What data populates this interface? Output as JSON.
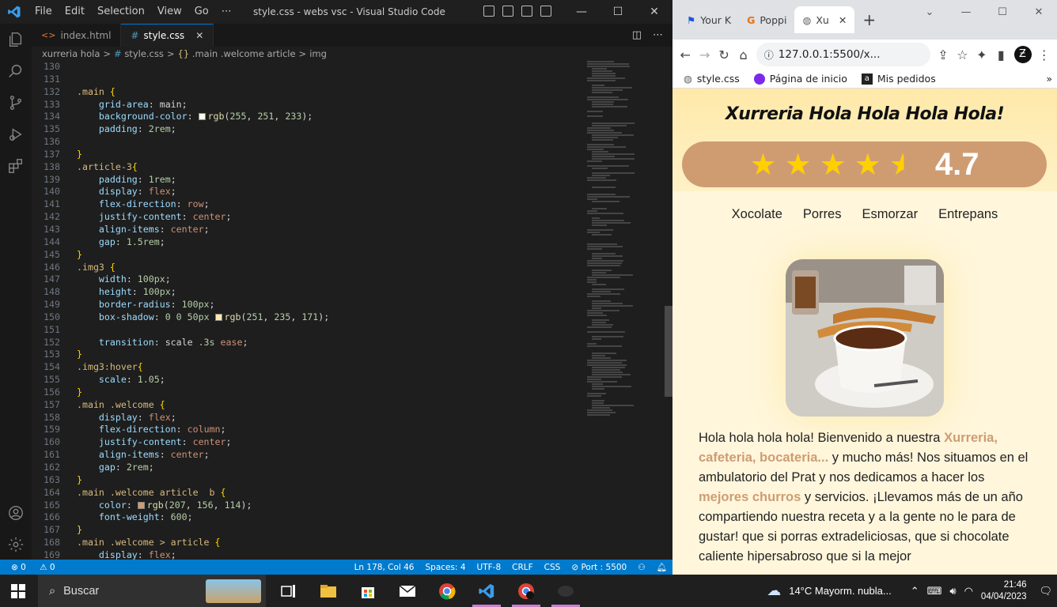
{
  "vscode": {
    "menu": [
      "File",
      "Edit",
      "Selection",
      "View",
      "Go",
      "⋯"
    ],
    "window_title": "style.css - webs vsc - Visual Studio Code",
    "tabs": [
      {
        "label": "index.html",
        "icon": "html-icon"
      },
      {
        "label": "style.css",
        "icon": "css-icon",
        "active": true
      }
    ],
    "breadcrumb": [
      "xurreria hola",
      ">",
      "style.css",
      ">",
      ".main .welcome article",
      ">",
      "img"
    ],
    "code_lines": [
      {
        "n": "130",
        "html": ""
      },
      {
        "n": "131",
        "html": ""
      },
      {
        "n": "132",
        "html": "<span class='sel'>.main</span> <span class='br'>{</span>"
      },
      {
        "n": "133",
        "html": "    <span class='prop'>grid-area</span>: main;"
      },
      {
        "n": "134",
        "html": "    <span class='prop'>background-color</span>: <span class='sw' style='background:rgb(255,251,233)'></span><span class='fn'>rgb</span>(<span class='num'>255</span>, <span class='num'>251</span>, <span class='num'>233</span>);"
      },
      {
        "n": "135",
        "html": "    <span class='prop'>padding</span>: <span class='num'>2rem</span>;"
      },
      {
        "n": "136",
        "html": ""
      },
      {
        "n": "137",
        "html": "<span class='br'>}</span>"
      },
      {
        "n": "138",
        "html": "<span class='sel'>.article-3</span><span class='br'>{</span>"
      },
      {
        "n": "139",
        "html": "    <span class='prop'>padding</span>: <span class='num'>1rem</span>;"
      },
      {
        "n": "140",
        "html": "    <span class='prop'>display</span>: <span class='str'>flex</span>;"
      },
      {
        "n": "141",
        "html": "    <span class='prop'>flex-direction</span>: <span class='str'>row</span>;"
      },
      {
        "n": "142",
        "html": "    <span class='prop'>justify-content</span>: <span class='str'>center</span>;"
      },
      {
        "n": "143",
        "html": "    <span class='prop'>align-items</span>: <span class='str'>center</span>;"
      },
      {
        "n": "144",
        "html": "    <span class='prop'>gap</span>: <span class='num'>1.5rem</span>;"
      },
      {
        "n": "145",
        "html": "<span class='br'>}</span>"
      },
      {
        "n": "146",
        "html": "<span class='sel'>.img3</span> <span class='br'>{</span>"
      },
      {
        "n": "147",
        "html": "    <span class='prop'>width</span>: <span class='num'>100px</span>;"
      },
      {
        "n": "148",
        "html": "    <span class='prop'>height</span>: <span class='num'>100px</span>;"
      },
      {
        "n": "149",
        "html": "    <span class='prop'>border-radius</span>: <span class='num'>100px</span>;"
      },
      {
        "n": "150",
        "html": "    <span class='prop'>box-shadow</span>: <span class='num'>0</span> <span class='num'>0</span> <span class='num'>50px</span> <span class='sw' style='background:rgb(251,235,171)'></span><span class='fn'>rgb</span>(<span class='num'>251</span>, <span class='num'>235</span>, <span class='num'>171</span>);"
      },
      {
        "n": "151",
        "html": ""
      },
      {
        "n": "152",
        "html": "    <span class='prop'>transition</span>: scale <span class='num'>.3s</span> <span class='str'>ease</span>;"
      },
      {
        "n": "153",
        "html": "<span class='br'>}</span>"
      },
      {
        "n": "154",
        "html": "<span class='sel'>.img3:hover</span><span class='br'>{</span>"
      },
      {
        "n": "155",
        "html": "    <span class='prop'>scale</span>: <span class='num'>1.05</span>;"
      },
      {
        "n": "156",
        "html": "<span class='br'>}</span>"
      },
      {
        "n": "157",
        "html": "<span class='sel'>.main .welcome</span> <span class='br'>{</span>"
      },
      {
        "n": "158",
        "html": "    <span class='prop'>display</span>: <span class='str'>flex</span>;"
      },
      {
        "n": "159",
        "html": "    <span class='prop'>flex-direction</span>: <span class='str'>column</span>;"
      },
      {
        "n": "160",
        "html": "    <span class='prop'>justify-content</span>: <span class='str'>center</span>;"
      },
      {
        "n": "161",
        "html": "    <span class='prop'>align-items</span>: <span class='str'>center</span>;"
      },
      {
        "n": "162",
        "html": "    <span class='prop'>gap</span>: <span class='num'>2rem</span>;"
      },
      {
        "n": "163",
        "html": "<span class='br'>}</span>"
      },
      {
        "n": "164",
        "html": "<span class='sel'>.main .welcome article  b</span> <span class='br'>{</span>"
      },
      {
        "n": "165",
        "html": "    <span class='prop'>color</span>: <span class='sw' style='background:rgb(207,156,114)'></span><span class='fn'>rgb</span>(<span class='num'>207</span>, <span class='num'>156</span>, <span class='num'>114</span>);"
      },
      {
        "n": "166",
        "html": "    <span class='prop'>font-weight</span>: <span class='num'>600</span>;"
      },
      {
        "n": "167",
        "html": "<span class='br'>}</span>"
      },
      {
        "n": "168",
        "html": "<span class='sel'>.main .welcome &gt; article</span> <span class='br'>{</span>"
      },
      {
        "n": "169",
        "html": "    <span class='prop'>display</span>: <span class='str'>flex</span>;"
      }
    ],
    "status": {
      "errors": "⊗ 0",
      "warnings": "⚠ 0",
      "position": "Ln 178, Col 46",
      "spaces": "Spaces: 4",
      "encoding": "UTF-8",
      "eol": "CRLF",
      "language": "CSS",
      "port": "⊘ Port : 5500"
    },
    "window_controls": [
      "—",
      "☐",
      "✕"
    ]
  },
  "chrome": {
    "tabs": [
      {
        "label": "Your K",
        "icon": "flag-icon"
      },
      {
        "label": "Poppi",
        "icon": "font-icon"
      },
      {
        "label": "Xu",
        "icon": "globe-icon",
        "active": true
      }
    ],
    "url": "127.0.0.1:5500/x...",
    "bookmarks": [
      {
        "label": "style.css",
        "icon": "globe-icon"
      },
      {
        "label": "Página de inicio",
        "icon": "canva-icon"
      },
      {
        "label": "Mis pedidos",
        "icon": "amazon-icon"
      }
    ],
    "window_controls": [
      "⌄",
      "—",
      "☐",
      "✕"
    ]
  },
  "page": {
    "title": "Xurreria Hola Hola Hola Hola!",
    "rating": {
      "value": 4.7,
      "label": "4.7",
      "stars": 5
    },
    "nav": [
      "Xocolate",
      "Porres",
      "Esmorzar",
      "Entrepans"
    ],
    "para": {
      "t1": "Hola hola hola hola! Bienvenido a nuestra ",
      "b1": "Xurreria, cafeteria, bocateria...",
      "t2": " y mucho más! Nos situamos en el ambulatorio del Prat y nos dedicamos a hacer los ",
      "b2": "mejores churros",
      "t3": " y servicios. ¡Llevamos más de un año compartiendo nuestra receta y a la gente no le para de gustar! que si porras extradeliciosas, que si chocolate caliente hipersabroso que si la mejor"
    }
  },
  "taskbar": {
    "search_placeholder": "Buscar",
    "weather": "14°C  Mayorm. nubla...",
    "time": "21:46",
    "date": "04/04/2023"
  },
  "colors": {
    "vscode_accent": "#007acc",
    "brand_brown": "#cf9c72",
    "star": "#ffd000",
    "page_bg": "#fff6dc"
  }
}
